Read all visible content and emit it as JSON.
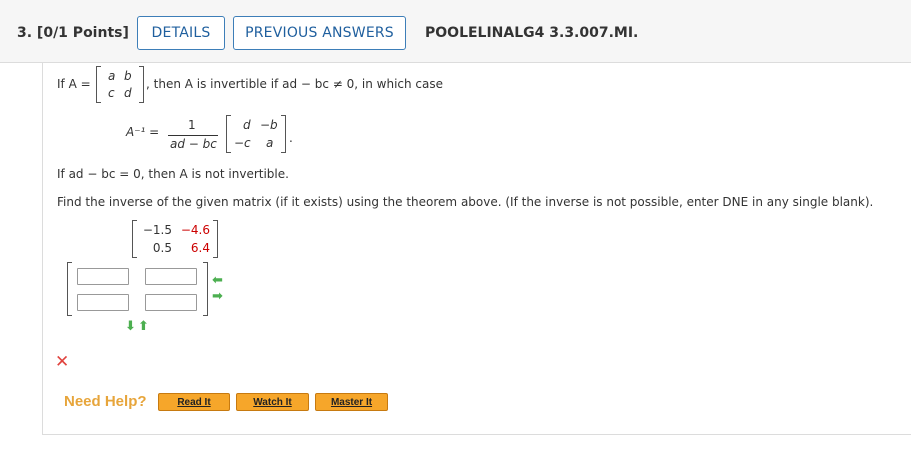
{
  "header": {
    "question_number": "3. [0/1 Points]",
    "details_label": "DETAILS",
    "previous_answers_label": "PREVIOUS ANSWERS",
    "question_id": "POOLELINALG4 3.3.007.MI."
  },
  "theorem": {
    "if_a": "If A =",
    "matrix": [
      [
        "a",
        "b"
      ],
      [
        "c",
        "d"
      ]
    ],
    "then_text": ", then A is invertible if ad − bc ≠ 0, in which case",
    "inv_lhs": "A⁻¹ =",
    "frac_num": "1",
    "frac_den": "ad − bc",
    "inv_matrix": [
      [
        "d",
        "−b"
      ],
      [
        "−c",
        "a"
      ]
    ],
    "not_invertible": "If ad − bc = 0, then A is not invertible."
  },
  "instruction": "Find the inverse of the given matrix (if it exists) using the theorem above. (If the inverse is not possible, enter DNE in any single blank).",
  "given_matrix": [
    [
      "−1.5",
      "−4.6"
    ],
    [
      "0.5",
      "6.4"
    ]
  ],
  "answer_grid": {
    "values": [
      [
        "",
        ""
      ],
      [
        "",
        ""
      ]
    ],
    "status": "incorrect"
  },
  "help": {
    "label": "Need Help?",
    "buttons": [
      "Read It",
      "Watch It",
      "Master It"
    ]
  },
  "colors": {
    "accent": "#1f5f9e",
    "highlight_red": "#cc0000",
    "help_orange": "#e7a53b",
    "button_orange": "#f6a62a",
    "error_x": "#e0433e"
  }
}
